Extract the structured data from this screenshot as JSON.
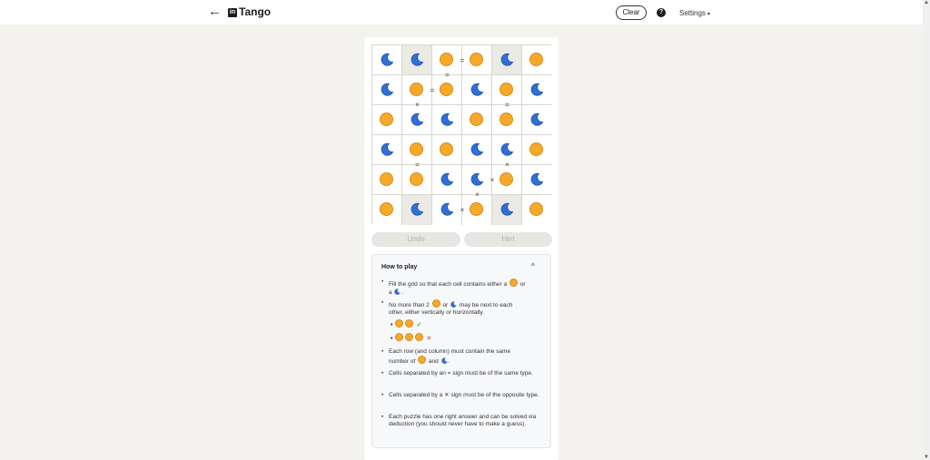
{
  "header": {
    "back_icon": "←",
    "logo_text": "in",
    "title": "Tango",
    "clear_label": "Clear",
    "help_icon": "?",
    "settings_label": "Settings",
    "settings_caret": "▾"
  },
  "board": {
    "rows": [
      [
        "moon",
        "moon",
        "sun",
        "sun",
        "moon",
        "sun"
      ],
      [
        "moon",
        "sun",
        "sun",
        "moon",
        "sun",
        "moon"
      ],
      [
        "sun",
        "moon",
        "moon",
        "sun",
        "sun",
        "moon"
      ],
      [
        "moon",
        "sun",
        "sun",
        "moon",
        "moon",
        "sun"
      ],
      [
        "sun",
        "sun",
        "moon",
        "moon",
        "sun",
        "moon"
      ],
      [
        "sun",
        "moon",
        "moon",
        "sun",
        "moon",
        "sun"
      ]
    ],
    "locked": [
      [
        0,
        1
      ],
      [
        0,
        4
      ],
      [
        5,
        1
      ],
      [
        5,
        4
      ]
    ],
    "constraints": [
      {
        "between": [
          [
            0,
            2
          ],
          [
            0,
            3
          ]
        ],
        "symbol": "="
      },
      {
        "between": [
          [
            0,
            2
          ],
          [
            1,
            2
          ]
        ],
        "symbol": "="
      },
      {
        "between": [
          [
            1,
            1
          ],
          [
            1,
            2
          ]
        ],
        "symbol": "="
      },
      {
        "between": [
          [
            1,
            1
          ],
          [
            2,
            1
          ]
        ],
        "symbol": "×"
      },
      {
        "between": [
          [
            1,
            4
          ],
          [
            2,
            4
          ]
        ],
        "symbol": "="
      },
      {
        "between": [
          [
            3,
            1
          ],
          [
            4,
            1
          ]
        ],
        "symbol": "="
      },
      {
        "between": [
          [
            3,
            4
          ],
          [
            4,
            4
          ]
        ],
        "symbol": "×"
      },
      {
        "between": [
          [
            4,
            3
          ],
          [
            4,
            4
          ]
        ],
        "symbol": "×"
      },
      {
        "between": [
          [
            4,
            3
          ],
          [
            5,
            3
          ]
        ],
        "symbol": "×"
      },
      {
        "between": [
          [
            5,
            2
          ],
          [
            5,
            3
          ]
        ],
        "symbol": "×"
      }
    ]
  },
  "controls": {
    "undo_label": "Undo",
    "hint_label": "Hint"
  },
  "how_to_play": {
    "title": "How to play",
    "toggle_icon": "^",
    "rule1_a": "Fill the grid so that each cell contains either a",
    "rule1_b": "or",
    "rule1_c": "a",
    "rule1_d": ".",
    "rule2_a": "No more than 2",
    "rule2_b": "or",
    "rule2_c": "may be next to each",
    "rule2_d": "other, either vertically or horizontally.",
    "example_ok": "✓",
    "example_bad": "✕",
    "rule3_a": "Each row (and column) must contain the same",
    "rule3_b": "number of",
    "rule3_c": "and",
    "rule3_d": ".",
    "rule4": "Cells separated by an = sign must be of the same type.",
    "rule5_a": "Cells separated by a",
    "rule5_sym": "✕",
    "rule5_b": "sign must be of the opposite type.",
    "rule6": "Each puzzle has one right answer and can be solved via deduction (you should never have to make a guess)."
  },
  "colors": {
    "sun": "#f7a928",
    "moon": "#2f6fd6",
    "locked_cell": "#ebe9e4"
  }
}
